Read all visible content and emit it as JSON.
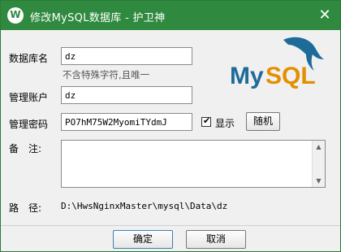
{
  "window": {
    "title": "修改MySQL数据库 - 护卫神",
    "app_icon_letter": "W",
    "close_glyph": "✕"
  },
  "logo": {
    "text_my": "My",
    "text_sql": "SQL",
    "color_blue": "#1e6b9a",
    "color_orange": "#e48e00"
  },
  "form": {
    "db_name_label": "数据库名",
    "db_name_value": "dz",
    "db_name_hint": "不含特殊字符,且唯一",
    "account_label": "管理账户",
    "account_value": "dz",
    "password_label": "管理密码",
    "password_value": "PO7hM75W2MyomiTYdmJ",
    "show_label": "显示",
    "show_checked": true,
    "random_label": "随机",
    "notes_label": "备　注:",
    "notes_value": "",
    "path_label": "路　径:",
    "path_value": "D:\\HwsNginxMaster\\mysql\\Data\\dz"
  },
  "buttons": {
    "ok": "确定",
    "cancel": "取消"
  },
  "colors": {
    "titlebar": "#2f8a3f",
    "dialog_bg": "#f0f0f0"
  }
}
